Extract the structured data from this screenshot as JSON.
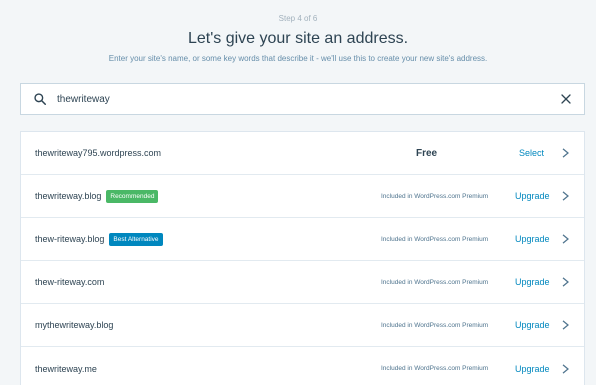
{
  "header": {
    "step": "Step 4 of 6",
    "title": "Let's give your site an address.",
    "subtitle": "Enter your site's name, or some key words that describe it - we'll use this to create your new site's address."
  },
  "search": {
    "value": "thewriteway",
    "icon": "search-icon",
    "clear_icon": "close-icon"
  },
  "colors": {
    "accent": "#0087be",
    "recommended": "#4ab866",
    "best_alternative": "#0087be"
  },
  "results": [
    {
      "domain": "thewriteway795.wordpress.com",
      "badge": "",
      "price": "Free",
      "action": "Select"
    },
    {
      "domain": "thewriteway.blog",
      "badge": "Recommended",
      "price": "Included in WordPress.com Premium",
      "action": "Upgrade"
    },
    {
      "domain": "thew-riteway.blog",
      "badge": "Best Alternative",
      "price": "Included in WordPress.com Premium",
      "action": "Upgrade"
    },
    {
      "domain": "thew-riteway.com",
      "badge": "",
      "price": "Included in WordPress.com Premium",
      "action": "Upgrade"
    },
    {
      "domain": "mythewriteway.blog",
      "badge": "",
      "price": "Included in WordPress.com Premium",
      "action": "Upgrade"
    },
    {
      "domain": "thewriteway.me",
      "badge": "",
      "price": "Included in WordPress.com Premium",
      "action": "Upgrade"
    }
  ]
}
